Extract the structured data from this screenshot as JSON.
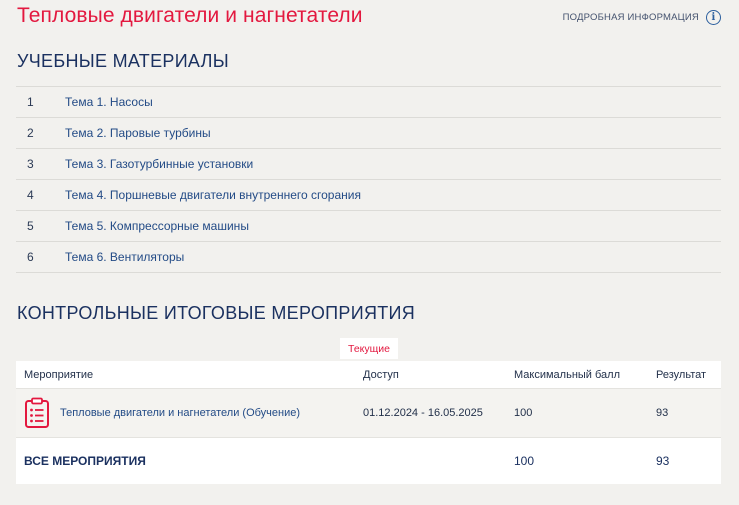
{
  "header": {
    "title": "Тепловые двигатели и нагнетатели",
    "info_label": "ПОДРОБНАЯ ИНФОРМАЦИЯ",
    "info_icon": "info-circle-icon"
  },
  "materials": {
    "heading": "УЧЕБНЫЕ МАТЕРИАЛЫ",
    "items": [
      {
        "num": "1",
        "label": "Тема 1. Насосы"
      },
      {
        "num": "2",
        "label": "Тема 2. Паровые турбины"
      },
      {
        "num": "3",
        "label": "Тема 3. Газотурбинные установки"
      },
      {
        "num": "4",
        "label": "Тема 4. Поршневые двигатели внутреннего сгорания"
      },
      {
        "num": "5",
        "label": "Тема 5. Компрессорные машины"
      },
      {
        "num": "6",
        "label": "Тема 6. Вентиляторы"
      }
    ]
  },
  "events": {
    "heading": "КОНТРОЛЬНЫЕ ИТОГОВЫЕ МЕРОПРИЯТИЯ",
    "tab_current": "Текущие",
    "columns": {
      "event": "Мероприятие",
      "access": "Доступ",
      "max_score": "Максимальный балл",
      "result": "Результат"
    },
    "rows": [
      {
        "icon": "clipboard-list-icon",
        "name": "Тепловые двигатели и нагнетатели (Обучение)",
        "access": "01.12.2024 - 16.05.2025",
        "max_score": "100",
        "result": "93"
      }
    ],
    "total": {
      "label": "ВСЕ МЕРОПРИЯТИЯ",
      "max_score": "100",
      "result": "93"
    }
  },
  "colors": {
    "accent": "#e3183f",
    "heading": "#1b3160",
    "link": "#234b86",
    "background": "#f2f1ee"
  }
}
